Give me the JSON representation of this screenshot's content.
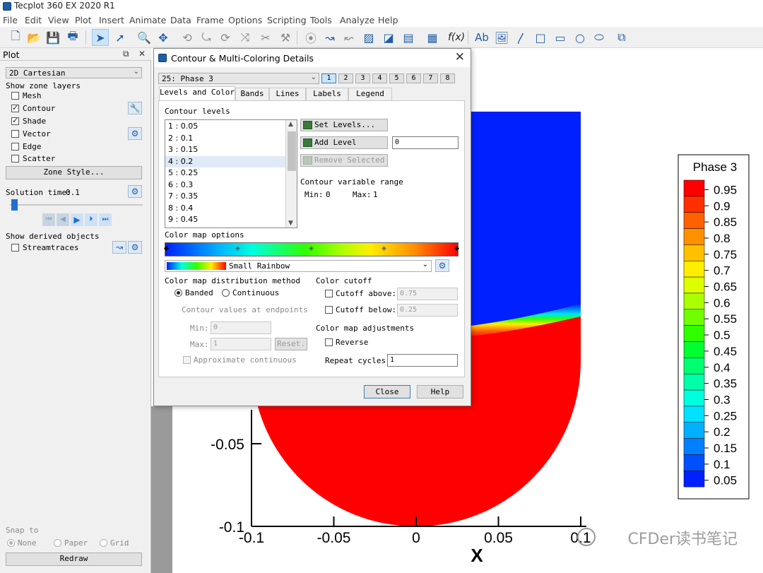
{
  "window": {
    "title": "Tecplot 360 EX 2020 R1"
  },
  "menu": [
    {
      "label": "File",
      "x": 4
    },
    {
      "label": "Edit",
      "x": 35
    },
    {
      "label": "View",
      "x": 68
    },
    {
      "label": "Plot",
      "x": 106
    },
    {
      "label": "Insert",
      "x": 140
    },
    {
      "label": "Animate",
      "x": 183
    },
    {
      "label": "Data",
      "x": 241
    },
    {
      "label": "Frame",
      "x": 278
    },
    {
      "label": "Options",
      "x": 323
    },
    {
      "label": "Scripting",
      "x": 378
    },
    {
      "label": "Tools",
      "x": 439
    },
    {
      "label": "Analyze",
      "x": 481
    },
    {
      "label": "Help",
      "x": 535
    }
  ],
  "left_panel": {
    "header": "Plot",
    "plot_type": "2D Cartesian",
    "zone_layers_label": "Show zone layers",
    "layers": [
      {
        "label": "Mesh",
        "checked": false
      },
      {
        "label": "Contour",
        "checked": true
      },
      {
        "label": "Shade",
        "checked": true
      },
      {
        "label": "Vector",
        "checked": false
      },
      {
        "label": "Edge",
        "checked": false
      },
      {
        "label": "Scatter",
        "checked": false
      }
    ],
    "zone_style_button": "Zone Style...",
    "solution_time_label": "Solution time:",
    "solution_time_value": "0.1",
    "derived_label": "Show derived objects",
    "streamtraces_label": "Streamtraces",
    "snap_label": "Snap to",
    "snap_options": [
      "None",
      "Paper",
      "Grid"
    ],
    "redraw_button": "Redraw"
  },
  "dialog": {
    "title": "Contour & Multi-Coloring Details",
    "variable": "25: Phase 3",
    "group_numbers": [
      "1",
      "2",
      "3",
      "4",
      "5",
      "6",
      "7",
      "8"
    ],
    "tabs": [
      "Levels and Color",
      "Bands",
      "Lines",
      "Labels",
      "Legend"
    ],
    "contour_levels_label": "Contour levels",
    "levels": [
      {
        "index": "1",
        "value": "0.05"
      },
      {
        "index": "2",
        "value": "0.1"
      },
      {
        "index": "3",
        "value": "0.15"
      },
      {
        "index": "4",
        "value": "0.2"
      },
      {
        "index": "5",
        "value": "0.25"
      },
      {
        "index": "6",
        "value": "0.3"
      },
      {
        "index": "7",
        "value": "0.35"
      },
      {
        "index": "8",
        "value": "0.4"
      },
      {
        "index": "9",
        "value": "0.45"
      }
    ],
    "set_levels_button": "Set Levels...",
    "add_level_button": "Add Level",
    "add_level_value": "0",
    "remove_selected_button": "Remove Selected",
    "var_range_label": "Contour variable range",
    "var_min_label": "Min:",
    "var_min": "0",
    "var_max_label": "Max:",
    "var_max": "1",
    "color_map_options_label": "Color map options",
    "color_map_name": "Small Rainbow",
    "distribution_label": "Color map distribution method",
    "banded_label": "Banded",
    "continuous_label": "Continuous",
    "endpoints_label": "Contour values at endpoints",
    "min_label": "Min:",
    "min_value": "0",
    "max_label": "Max:",
    "max_value": "1",
    "reset_button": "Reset.",
    "approx_label": "Approximate continuous",
    "cutoff_label": "Color cutoff",
    "cutoff_above_label": "Cutoff above:",
    "cutoff_above_value": "0.75",
    "cutoff_below_label": "Cutoff below:",
    "cutoff_below_value": "0.25",
    "adjust_label": "Color map adjustments",
    "reverse_label": "Reverse",
    "repeat_label": "Repeat cycles:",
    "repeat_value": "1",
    "close_button": "Close",
    "help_button": "Help"
  },
  "legend": {
    "title": "Phase 3",
    "levels": [
      "0.95",
      "0.9",
      "0.85",
      "0.8",
      "0.75",
      "0.7",
      "0.65",
      "0.6",
      "0.55",
      "0.5",
      "0.45",
      "0.4",
      "0.35",
      "0.3",
      "0.25",
      "0.2",
      "0.15",
      "0.1",
      "0.05"
    ],
    "colors": [
      "#ff0000",
      "#ff3000",
      "#ff6000",
      "#ff9000",
      "#ffc000",
      "#ffee00",
      "#ddff00",
      "#aaff00",
      "#70ff00",
      "#30ff00",
      "#00ff30",
      "#00ff70",
      "#00ffa8",
      "#00ffdd",
      "#00e0ff",
      "#00b0ff",
      "#0080ff",
      "#0050ff",
      "#0020ff"
    ]
  },
  "chart_data": {
    "type": "heatmap",
    "title": "",
    "xlabel": "X",
    "ylabel": "",
    "x_ticks": [
      "-0.1",
      "-0.05",
      "0",
      "0.05",
      "0.1"
    ],
    "y_ticks": [
      "-0.05",
      "-0.1"
    ],
    "variable": "Phase 3",
    "regions": [
      {
        "name": "upper",
        "value": 0.0,
        "color": "#0020ff"
      },
      {
        "name": "lower",
        "value": 1.0,
        "color": "#ff0000"
      }
    ]
  },
  "watermark": "CFDer读书笔记"
}
